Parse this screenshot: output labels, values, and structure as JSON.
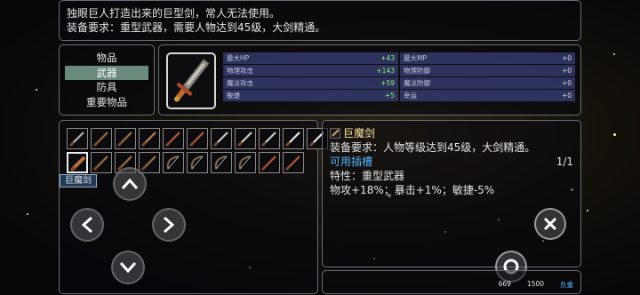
{
  "description": {
    "line1": "独眼巨人打造出来的巨型剑，常人无法使用。",
    "line2": "装备要求：重型武器，需要人物达到45级，大剑精通。"
  },
  "categories": [
    {
      "label": "物品",
      "active": false
    },
    {
      "label": "武器",
      "active": true
    },
    {
      "label": "防具",
      "active": false
    },
    {
      "label": "重要物品",
      "active": false
    }
  ],
  "stats": [
    [
      {
        "label": "最大HP",
        "value": "+43",
        "positive": true
      },
      {
        "label": "最大MP",
        "value": "+0",
        "positive": false
      }
    ],
    [
      {
        "label": "物理攻击",
        "value": "+143",
        "positive": true
      },
      {
        "label": "物理防御",
        "value": "+0",
        "positive": false
      }
    ],
    [
      {
        "label": "魔法攻击",
        "value": "+59",
        "positive": true
      },
      {
        "label": "魔法防御",
        "value": "+0",
        "positive": false
      }
    ],
    [
      {
        "label": "敏捷",
        "value": "+5",
        "positive": true
      },
      {
        "label": "幸运",
        "value": "+0",
        "positive": false
      }
    ]
  ],
  "inventory": {
    "row1_icons": [
      "spear-icon",
      "wooden-staff-icon",
      "long-spear-icon",
      "dagger-icon",
      "red-sword-icon",
      "red-sword-icon",
      "steel-sword-icon",
      "steel-sword-icon",
      "steel-sword-icon",
      "white-sword-icon",
      "white-sword-icon"
    ],
    "row2_icons": [
      "great-sword-icon",
      "long-spear-icon",
      "long-spear-icon",
      "long-spear-icon",
      "bow-icon",
      "bow-icon",
      "bow-icon",
      "bow-icon",
      "red-sword-icon",
      "red-sword-icon"
    ],
    "tooltip": "巨魔剑"
  },
  "detail": {
    "name": "巨魔剑",
    "requirement": "装备要求：人物等级达到45级，大剑精通。",
    "slots_label": "可用插槽",
    "slots_count": "1/1",
    "trait": "特性：重型武器",
    "effects": "物攻+18%；暴击+1%；敏捷-5%"
  },
  "footer": {
    "value1": "669",
    "value2": "1500",
    "label": "负重"
  },
  "colors": {
    "accent_blue": "#57b5ff",
    "item_name": "#ffe9a3",
    "stat_positive": "#8ff07a",
    "menu_active": "#6a8a7c"
  }
}
